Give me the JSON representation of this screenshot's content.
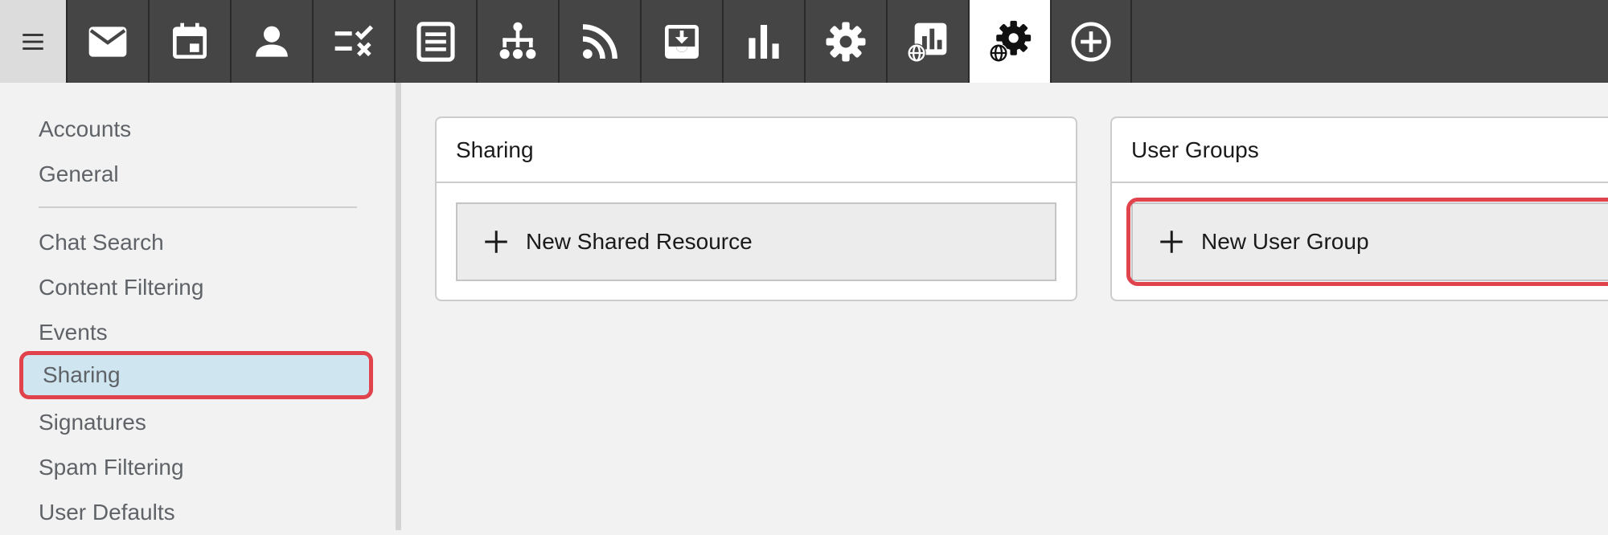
{
  "toolbar": {
    "items": [
      {
        "icon": "menu-icon"
      },
      {
        "icon": "mail-icon"
      },
      {
        "icon": "calendar-icon"
      },
      {
        "icon": "contacts-icon"
      },
      {
        "icon": "tasks-icon"
      },
      {
        "icon": "notes-icon"
      },
      {
        "icon": "org-chart-icon"
      },
      {
        "icon": "rss-icon"
      },
      {
        "icon": "inbox-icon"
      },
      {
        "icon": "reports-icon"
      },
      {
        "icon": "settings-icon"
      },
      {
        "icon": "domain-reports-icon"
      },
      {
        "icon": "domain-settings-icon",
        "active": true
      },
      {
        "icon": "add-circle-icon"
      }
    ]
  },
  "sidebar": {
    "items": [
      {
        "label": "Accounts"
      },
      {
        "label": "General"
      },
      {
        "label": "Chat Search"
      },
      {
        "label": "Content Filtering"
      },
      {
        "label": "Events"
      },
      {
        "label": "Sharing",
        "selected": true
      },
      {
        "label": "Signatures"
      },
      {
        "label": "Spam Filtering"
      },
      {
        "label": "User Defaults"
      }
    ]
  },
  "panels": {
    "sharing": {
      "title": "Sharing",
      "button_label": "New Shared Resource"
    },
    "user_groups": {
      "title": "User Groups",
      "button_label": "New User Group"
    }
  },
  "colors": {
    "toolbar_bg": "#454545",
    "active_tab_bg": "#ffffff",
    "selected_nav_bg": "#cfe5f0",
    "highlight": "#e0434b"
  }
}
